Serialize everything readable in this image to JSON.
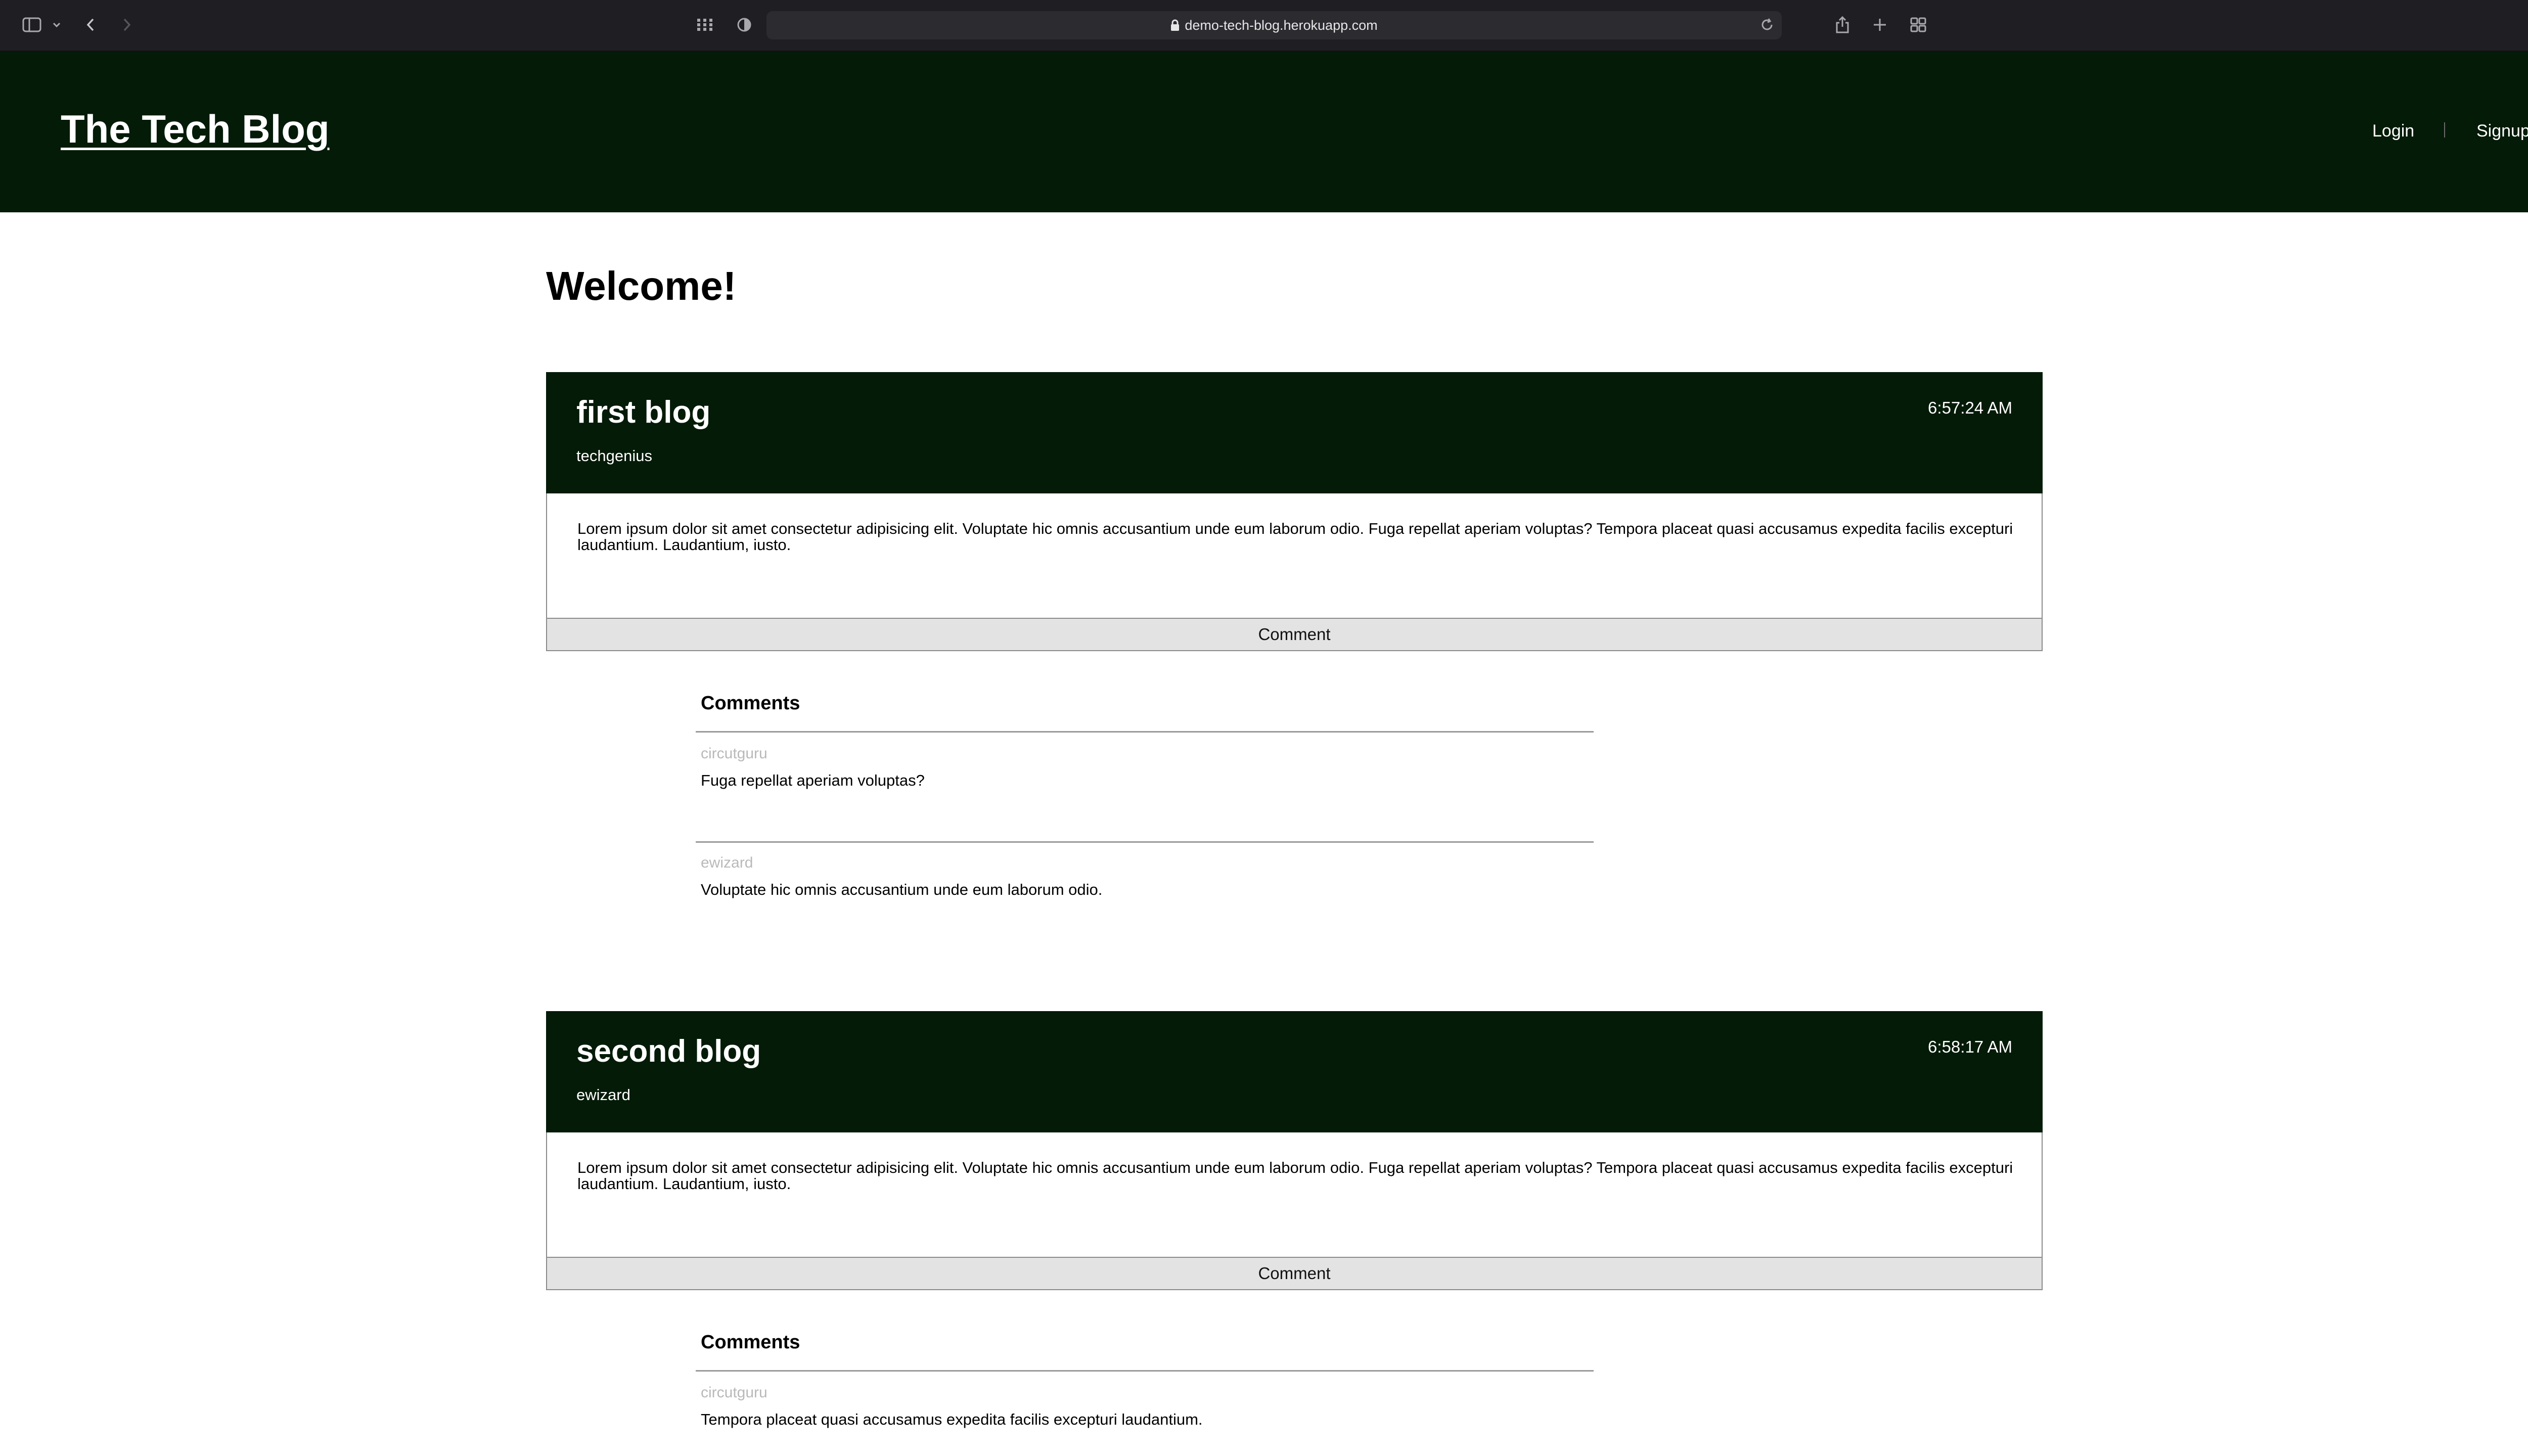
{
  "browser": {
    "url": "demo-tech-blog.herokuapp.com"
  },
  "site": {
    "title": "The Tech Blog",
    "nav": {
      "login": "Login",
      "signup": "Signup"
    }
  },
  "main": {
    "heading": "Welcome!",
    "posts": [
      {
        "title": "first blog",
        "author": "techgenius",
        "time": "6:57:24 AM",
        "body": "Lorem ipsum dolor sit amet consectetur adipisicing elit. Voluptate hic omnis accusantium unde eum laborum odio. Fuga repellat aperiam voluptas? Tempora placeat quasi accusamus expedita facilis excepturi laudantium. Laudantium, iusto.",
        "comment_button": "Comment",
        "comments_heading": "Comments",
        "comments": [
          {
            "author": "circutguru",
            "text": "Fuga repellat aperiam voluptas?"
          },
          {
            "author": "ewizard",
            "text": "Voluptate hic omnis accusantium unde eum laborum odio."
          }
        ]
      },
      {
        "title": "second blog",
        "author": "ewizard",
        "time": "6:58:17 AM",
        "body": "Lorem ipsum dolor sit amet consectetur adipisicing elit. Voluptate hic omnis accusantium unde eum laborum odio. Fuga repellat aperiam voluptas? Tempora placeat quasi accusamus expedita facilis excepturi laudantium. Laudantium, iusto.",
        "comment_button": "Comment",
        "comments_heading": "Comments",
        "comments": [
          {
            "author": "circutguru",
            "text": "Tempora placeat quasi accusamus expedita facilis excepturi laudantium."
          }
        ]
      }
    ]
  },
  "colors": {
    "header_bg": "#041b08",
    "comment_button_bg": "#e3e3e3",
    "comment_author": "#b9b9b9"
  }
}
